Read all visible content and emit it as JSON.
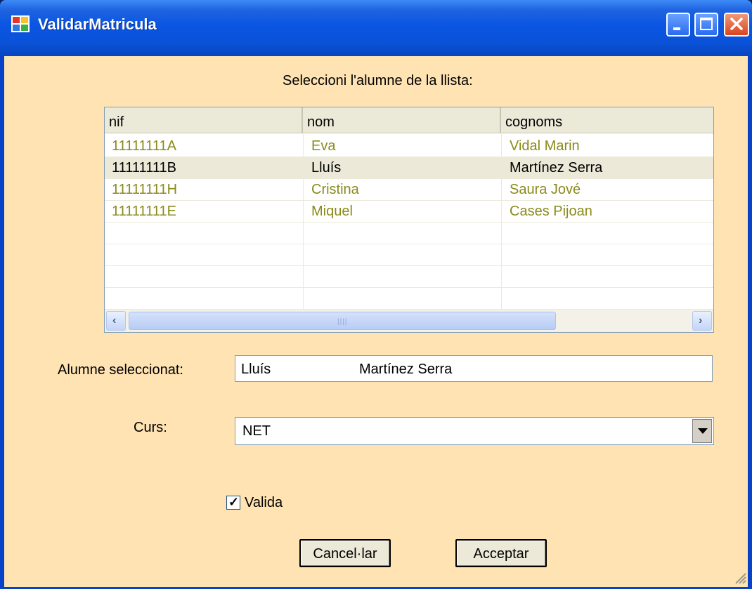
{
  "window": {
    "title": "ValidarMatricula",
    "controls": {
      "minimize": "minimize-icon",
      "maximize": "maximize-icon",
      "close": "close-icon"
    }
  },
  "prompt": "Seleccioni l'alumne de la llista:",
  "grid": {
    "columns": [
      "nif",
      "nom",
      "cognoms"
    ],
    "rows": [
      {
        "nif": "11111111A",
        "nom": "Eva",
        "cognoms": "Vidal Marin",
        "selected": false
      },
      {
        "nif": "11111111B",
        "nom": "Lluís",
        "cognoms": "Martínez Serra",
        "selected": true
      },
      {
        "nif": "11111111H",
        "nom": "Cristina",
        "cognoms": "Saura Jové",
        "selected": false
      },
      {
        "nif": "11111111E",
        "nom": "Miquel",
        "cognoms": "Cases Pijoan",
        "selected": false
      }
    ],
    "scroll_left_icon": "arrow-left-icon",
    "scroll_right_icon": "arrow-right-icon"
  },
  "selected_student": {
    "label": "Alumne seleccionat:",
    "nom": "Lluís",
    "cognoms": "Martínez Serra"
  },
  "course": {
    "label": "Curs:",
    "value": "NET"
  },
  "valid": {
    "label": "Valida",
    "checked": true
  },
  "buttons": {
    "cancel": "Cancel·lar",
    "accept": "Acceptar"
  },
  "colors": {
    "client_background": "#FFE3B3",
    "row_text": "#8A8A1A",
    "selected_row": "#ECE9D8"
  }
}
